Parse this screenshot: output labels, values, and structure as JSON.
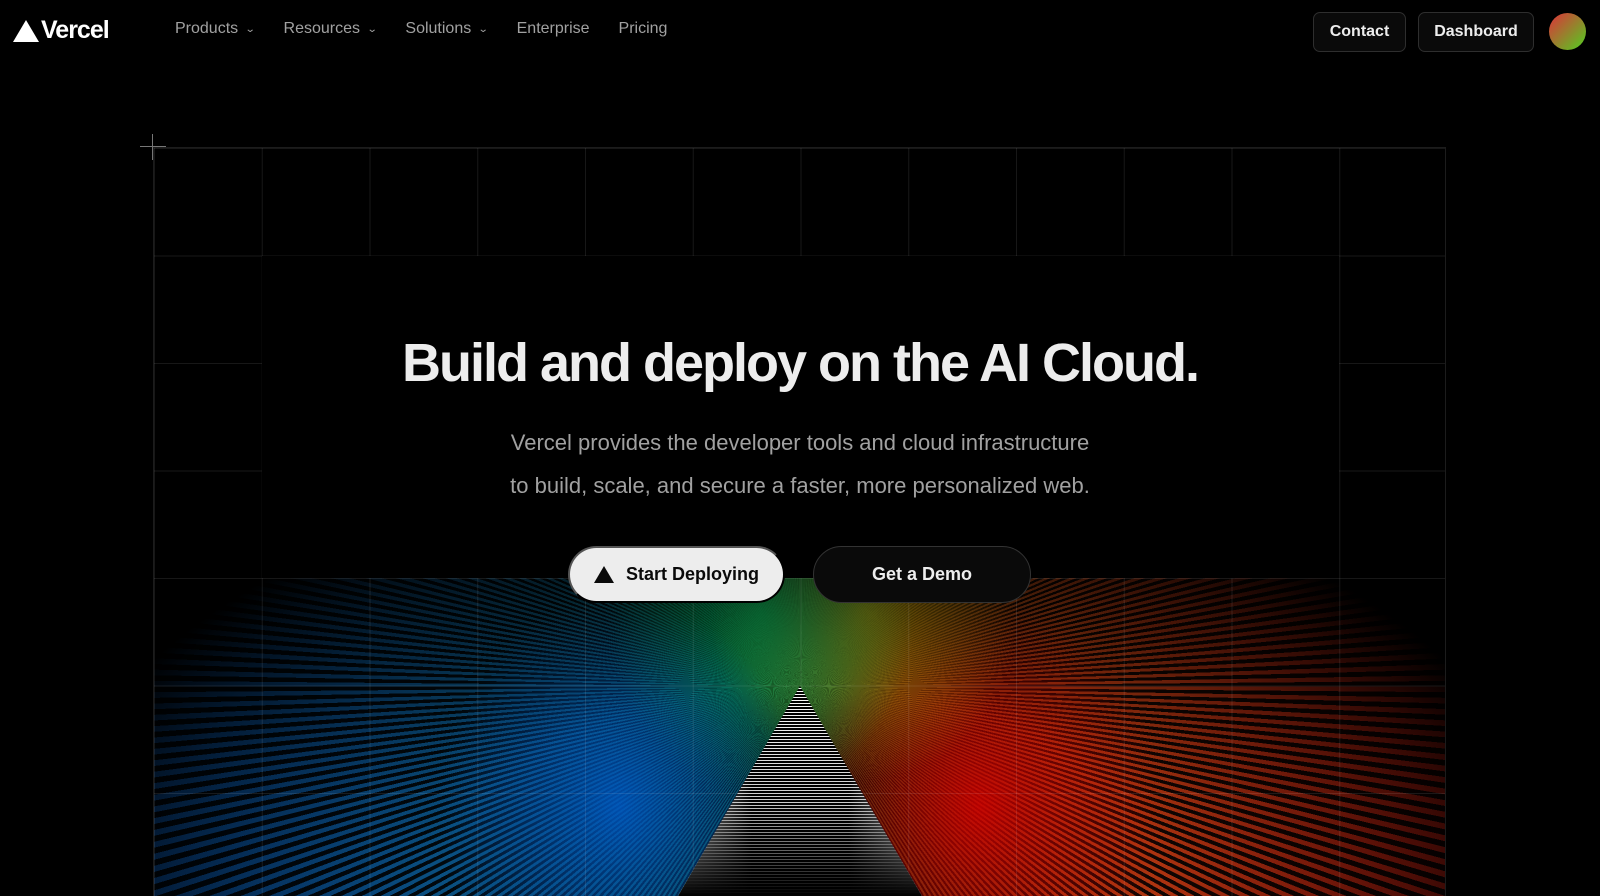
{
  "nav": {
    "brand": "Vercel",
    "items": [
      {
        "label": "Products",
        "dropdown": true
      },
      {
        "label": "Resources",
        "dropdown": true
      },
      {
        "label": "Solutions",
        "dropdown": true
      },
      {
        "label": "Enterprise",
        "dropdown": false
      },
      {
        "label": "Pricing",
        "dropdown": false
      }
    ],
    "contact": "Contact",
    "dashboard": "Dashboard"
  },
  "hero": {
    "title": "Build and deploy on the AI Cloud.",
    "subtitle_line1": "Vercel provides the developer tools and cloud infrastructure",
    "subtitle_line2": "to build, scale, and secure a faster, more personalized web.",
    "primary_cta": "Start Deploying",
    "secondary_cta": "Get a Demo"
  },
  "icons": {
    "logo": "vercel-triangle-icon",
    "chevron": "chevron-down-icon",
    "cta": "vercel-triangle-icon"
  }
}
